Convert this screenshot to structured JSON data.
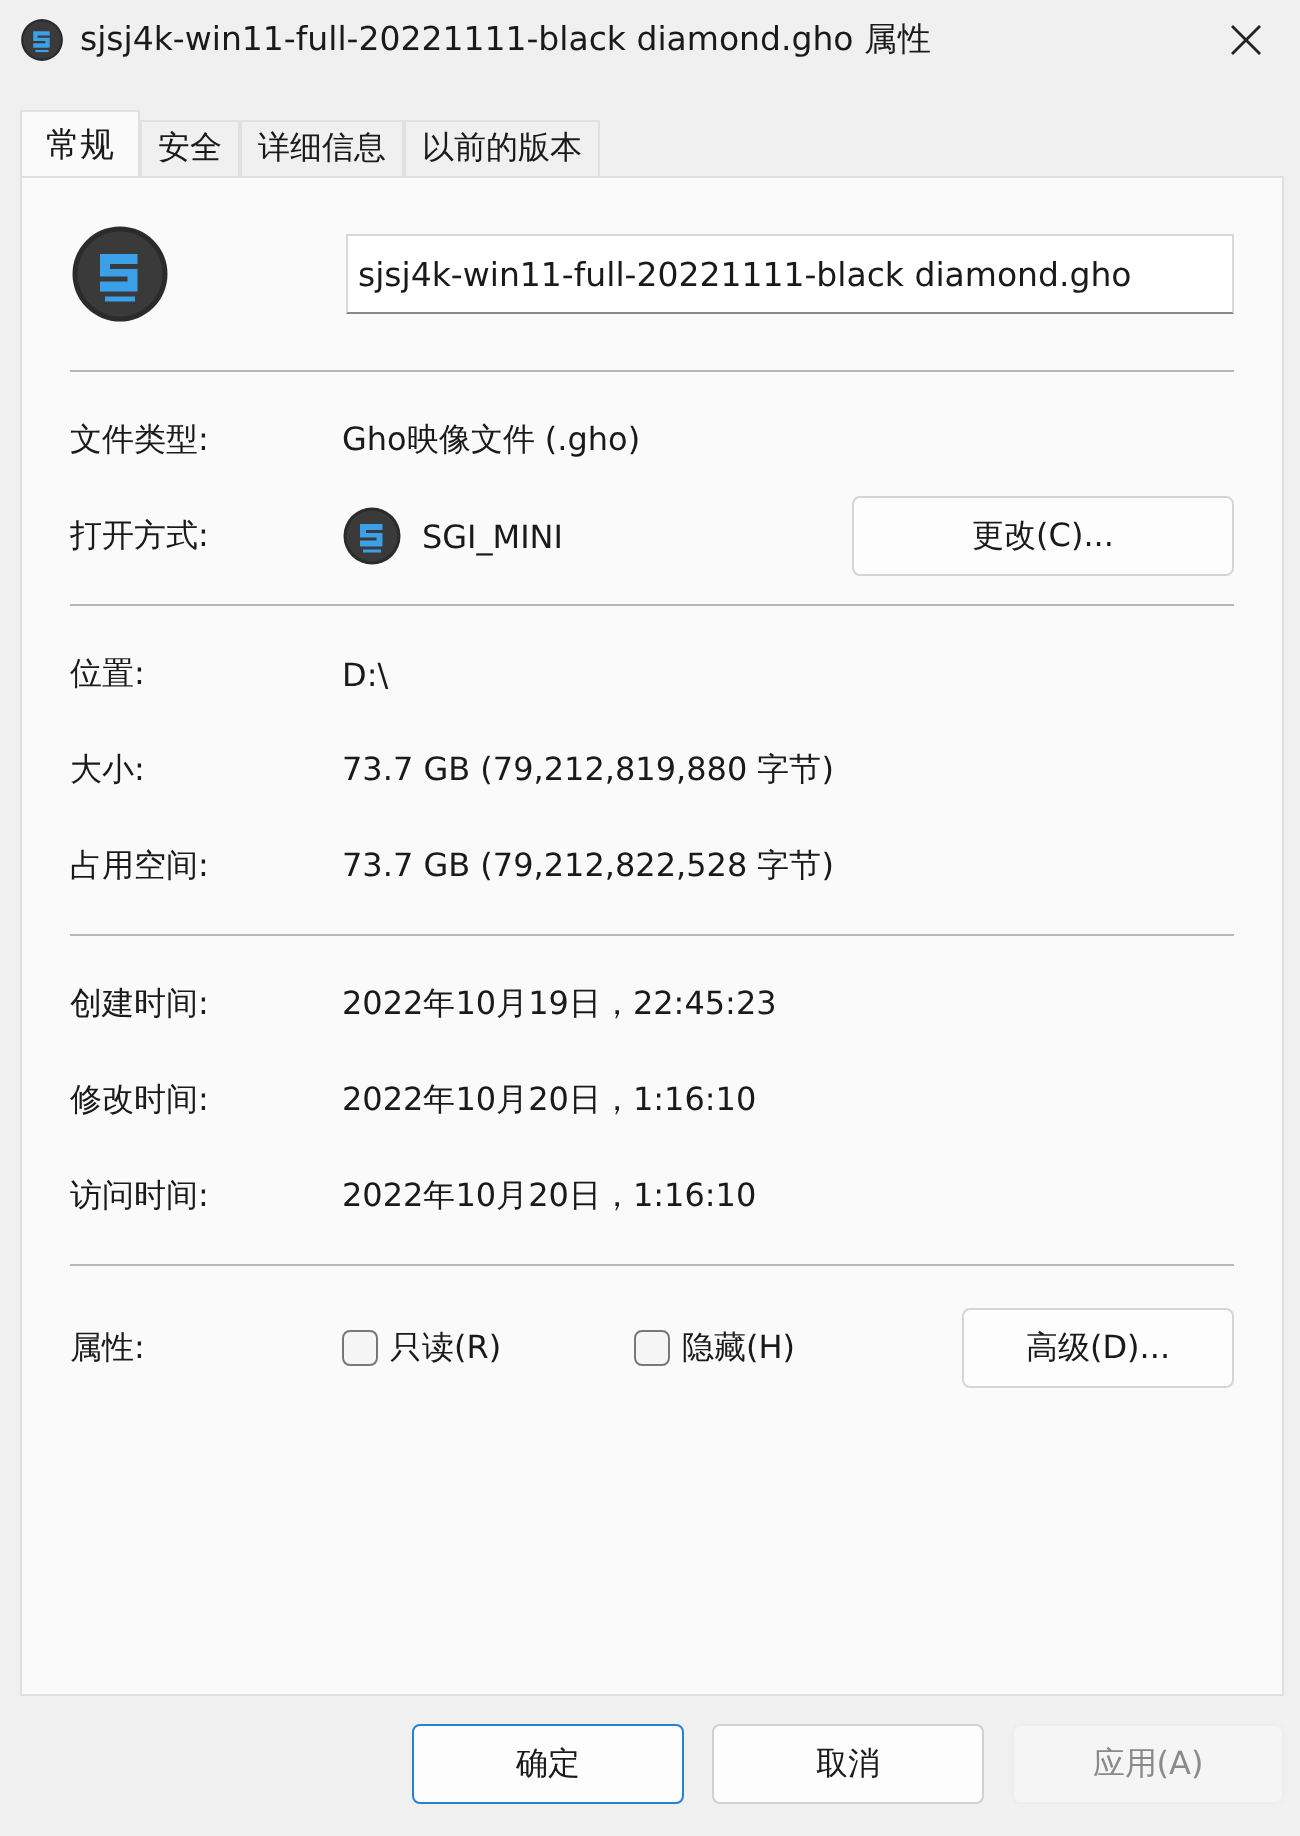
{
  "window": {
    "title": "sjsj4k-win11-full-20221111-black diamond.gho 属性"
  },
  "tabs": [
    {
      "label": "常规",
      "selected": true
    },
    {
      "label": "安全",
      "selected": false
    },
    {
      "label": "详细信息",
      "selected": false
    },
    {
      "label": "以前的版本",
      "selected": false
    }
  ],
  "file_name": {
    "value": "sjsj4k-win11-full-20221111-black diamond.gho"
  },
  "sections": [
    {
      "rows": [
        {
          "kind": "text",
          "label": "文件类型:",
          "value": "Gho映像文件 (.gho)"
        },
        {
          "kind": "app",
          "label": "打开方式:",
          "value": "SGI_MINI",
          "button": "更改(C)..."
        }
      ]
    },
    {
      "rows": [
        {
          "kind": "text",
          "label": "位置:",
          "value": "D:\\"
        },
        {
          "kind": "text",
          "label": "大小:",
          "value": "73.7 GB (79,212,819,880 字节)"
        },
        {
          "kind": "text",
          "label": "占用空间:",
          "value": "73.7 GB (79,212,822,528 字节)"
        }
      ]
    },
    {
      "rows": [
        {
          "kind": "text",
          "label": "创建时间:",
          "value": "2022年10月19日，22:45:23"
        },
        {
          "kind": "text",
          "label": "修改时间:",
          "value": "2022年10月20日，1:16:10"
        },
        {
          "kind": "text",
          "label": "访问时间:",
          "value": "2022年10月20日，1:16:10"
        }
      ]
    }
  ],
  "attributes": {
    "label": "属性:",
    "checkboxes": [
      {
        "label": "只读(R)",
        "checked": false
      },
      {
        "label": "隐藏(H)",
        "checked": false
      }
    ],
    "button": "高级(D)..."
  },
  "buttons": [
    {
      "label": "确定",
      "default": true,
      "disabled": false
    },
    {
      "label": "取消",
      "default": false,
      "disabled": false
    },
    {
      "label": "应用(A)",
      "default": false,
      "disabled": true
    }
  ]
}
